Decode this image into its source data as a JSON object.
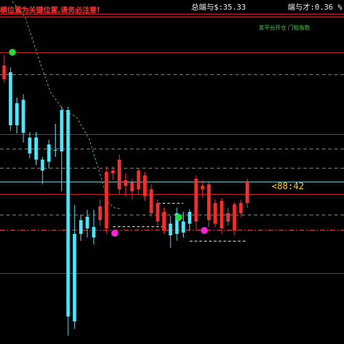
{
  "header": {
    "warning": "横位置为关键位置,请务必注意!",
    "indicator_left": "总端与$:35.33",
    "indicator_right": "端与才:0.36 %",
    "small_label": "某平台开仓 门槛指数"
  },
  "price_tag": "<88:42",
  "colors": {
    "background": "#000000",
    "bull": "#ff2a2a",
    "bear": "#44e8ff",
    "level_line": "#c81e1e",
    "dashed_gray": "#9a9a9a",
    "cyan_level": "#78c8d2",
    "dashdot_red": "#e03c3c",
    "green_trend": "#36d536",
    "green_dot": "#22dd33",
    "magenta_dot": "#ff22dd",
    "header_red": "#ff3030",
    "header_white": "#f0f0f0",
    "header_green": "#33cc33"
  },
  "chart_data": {
    "type": "candlestick",
    "ylim": [
      0,
      500
    ],
    "candles": [
      {
        "dir": "bull",
        "o": 385,
        "c": 405,
        "h": 420,
        "l": 380
      },
      {
        "dir": "bear",
        "o": 395,
        "c": 318,
        "h": 402,
        "l": 310
      },
      {
        "dir": "bear",
        "o": 350,
        "c": 318,
        "h": 358,
        "l": 306
      },
      {
        "dir": "bear",
        "o": 355,
        "c": 307,
        "h": 363,
        "l": 293
      },
      {
        "dir": "bear",
        "o": 300,
        "c": 277,
        "h": 308,
        "l": 270
      },
      {
        "dir": "bear",
        "o": 300,
        "c": 268,
        "h": 308,
        "l": 260
      },
      {
        "dir": "bear",
        "o": 268,
        "c": 252,
        "h": 272,
        "l": 232
      },
      {
        "dir": "bear",
        "o": 290,
        "c": 265,
        "h": 297,
        "l": 255
      },
      {
        "dir": "bear",
        "o": 282,
        "c": 282,
        "h": 320,
        "l": 272
      },
      {
        "dir": "bear",
        "o": 340,
        "c": 280,
        "h": 345,
        "l": 222
      },
      {
        "dir": "bear",
        "o": 340,
        "c": 40,
        "h": 345,
        "l": 12
      },
      {
        "dir": "bear",
        "o": 160,
        "c": 33,
        "h": 202,
        "l": 22
      },
      {
        "dir": "bear",
        "o": 180,
        "c": 160,
        "h": 188,
        "l": 150
      },
      {
        "dir": "bear",
        "o": 185,
        "c": 168,
        "h": 195,
        "l": 155
      },
      {
        "dir": "bear",
        "o": 170,
        "c": 155,
        "h": 195,
        "l": 145
      },
      {
        "dir": "bull",
        "o": 200,
        "c": 180,
        "h": 210,
        "l": 172
      },
      {
        "dir": "bull",
        "o": 168,
        "c": 250,
        "h": 258,
        "l": 160
      },
      {
        "dir": "bull",
        "o": 248,
        "c": 252,
        "h": 258,
        "l": 238
      },
      {
        "dir": "bull",
        "o": 225,
        "c": 268,
        "h": 275,
        "l": 218
      },
      {
        "dir": "bull",
        "o": 238,
        "c": 230,
        "h": 248,
        "l": 215
      },
      {
        "dir": "bull",
        "o": 235,
        "c": 222,
        "h": 240,
        "l": 210
      },
      {
        "dir": "bull",
        "o": 225,
        "c": 252,
        "h": 255,
        "l": 218
      },
      {
        "dir": "bull",
        "o": 215,
        "c": 245,
        "h": 250,
        "l": 208
      },
      {
        "dir": "bull",
        "o": 190,
        "c": 225,
        "h": 232,
        "l": 185
      },
      {
        "dir": "bull",
        "o": 178,
        "c": 205,
        "h": 210,
        "l": 172
      },
      {
        "dir": "bull",
        "o": 165,
        "c": 192,
        "h": 198,
        "l": 160
      },
      {
        "dir": "bear",
        "o": 175,
        "c": 158,
        "h": 186,
        "l": 140
      },
      {
        "dir": "bear",
        "o": 190,
        "c": 160,
        "h": 198,
        "l": 150
      },
      {
        "dir": "bear",
        "o": 178,
        "c": 162,
        "h": 192,
        "l": 155
      },
      {
        "dir": "bear",
        "o": 192,
        "c": 175,
        "h": 196,
        "l": 165
      },
      {
        "dir": "bull",
        "o": 178,
        "c": 240,
        "h": 245,
        "l": 165
      },
      {
        "dir": "bull",
        "o": 230,
        "c": 225,
        "h": 238,
        "l": 212
      },
      {
        "dir": "bull",
        "o": 180,
        "c": 232,
        "h": 235,
        "l": 170
      },
      {
        "dir": "bull",
        "o": 175,
        "c": 205,
        "h": 210,
        "l": 170
      },
      {
        "dir": "bull",
        "o": 168,
        "c": 208,
        "h": 212,
        "l": 160
      },
      {
        "dir": "bull",
        "o": 178,
        "c": 190,
        "h": 198,
        "l": 172
      },
      {
        "dir": "bull",
        "o": 165,
        "c": 203,
        "h": 206,
        "l": 158
      },
      {
        "dir": "bull",
        "o": 190,
        "c": 205,
        "h": 210,
        "l": 185
      },
      {
        "dir": "bull",
        "o": 205,
        "c": 237,
        "h": 240,
        "l": 198
      }
    ],
    "levels": [
      {
        "style": "solid-red",
        "y": 480
      },
      {
        "style": "solid-red",
        "y": 424
      },
      {
        "style": "dashed-gray",
        "y": 392
      },
      {
        "style": "solid-red",
        "y": 305
      },
      {
        "style": "dashed-gray",
        "y": 284
      },
      {
        "style": "dashed-gray",
        "y": 256
      },
      {
        "style": "solid-cyan",
        "y": 236
      },
      {
        "style": "solid-red",
        "y": 218
      },
      {
        "style": "dashed-gray",
        "y": 188
      },
      {
        "style": "dashdot-red",
        "y": 166
      },
      {
        "style": "solid-red",
        "y": 103
      }
    ],
    "trend_line": [
      [
        0,
        498
      ],
      [
        2,
        475
      ],
      [
        4,
        418
      ],
      [
        6,
        365
      ],
      [
        8,
        340
      ],
      [
        10,
        330
      ],
      [
        12,
        298
      ],
      [
        14,
        238
      ],
      [
        15,
        205
      ],
      [
        16,
        198
      ],
      [
        17,
        196
      ]
    ],
    "range_segments": [
      {
        "from": 17,
        "to": 25,
        "y": 171
      },
      {
        "from": 24,
        "to": 28,
        "y": 205
      },
      {
        "from": 29,
        "to": 38,
        "y": 150
      }
    ],
    "markers": [
      {
        "kind": "green",
        "at": 0,
        "y": 424
      },
      {
        "kind": "magenta",
        "at": 16,
        "y": 161
      },
      {
        "kind": "green",
        "at": 26,
        "y": 184
      },
      {
        "kind": "magenta",
        "at": 30,
        "y": 165
      }
    ]
  }
}
